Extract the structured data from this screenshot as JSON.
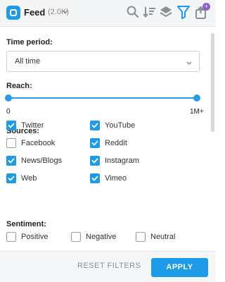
{
  "header": {
    "title": "Feed",
    "count": "(2.0K)",
    "icons": [
      "search-icon",
      "sort-icon",
      "layers-icon",
      "filter-icon",
      "share-icon"
    ],
    "share_badge": "+"
  },
  "time_period": {
    "label": "Time period:",
    "value": "All time"
  },
  "reach": {
    "label": "Reach:",
    "min_label": "0",
    "max_label": "1M+",
    "range": [
      0,
      1
    ]
  },
  "sources": {
    "label": "Sources:",
    "items": [
      {
        "label": "Twitter",
        "checked": true
      },
      {
        "label": "YouTube",
        "checked": true
      },
      {
        "label": "Facebook",
        "checked": false
      },
      {
        "label": "Reddit",
        "checked": true
      },
      {
        "label": "News/Blogs",
        "checked": true
      },
      {
        "label": "Instagram",
        "checked": true
      },
      {
        "label": "Web",
        "checked": true
      },
      {
        "label": "Vimeo",
        "checked": true
      }
    ]
  },
  "sentiment": {
    "label": "Sentiment:",
    "items": [
      {
        "label": "Positive",
        "checked": false
      },
      {
        "label": "Negative",
        "checked": false
      },
      {
        "label": "Neutral",
        "checked": false
      }
    ]
  },
  "footer": {
    "reset_label": "RESET FILTERS",
    "apply_label": "APPLY"
  },
  "colors": {
    "accent": "#1e9be8",
    "badge": "#8a5fd6"
  }
}
